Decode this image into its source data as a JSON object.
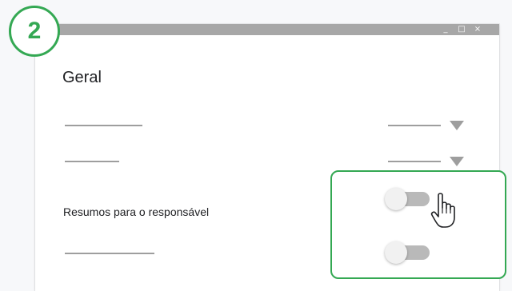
{
  "step_badge": "2",
  "window": {
    "title_controls": {
      "minimize": "_",
      "maximize": "□",
      "close": "×"
    },
    "heading": "Geral",
    "rows": [
      {
        "kind": "select-placeholder"
      },
      {
        "kind": "select-placeholder"
      },
      {
        "kind": "toggle-setting",
        "label": "Resumos para o responsável",
        "toggle_on": false
      },
      {
        "kind": "toggle-placeholder",
        "toggle_on": false
      }
    ]
  },
  "cursor": "hand-pointer-icon",
  "colors": {
    "accent_green": "#34a853",
    "titlebar": "#a7a7a7",
    "placeholder_gray": "#9e9e9e",
    "toggle_track": "#b9b9b9",
    "toggle_thumb": "#f1f1f1"
  }
}
